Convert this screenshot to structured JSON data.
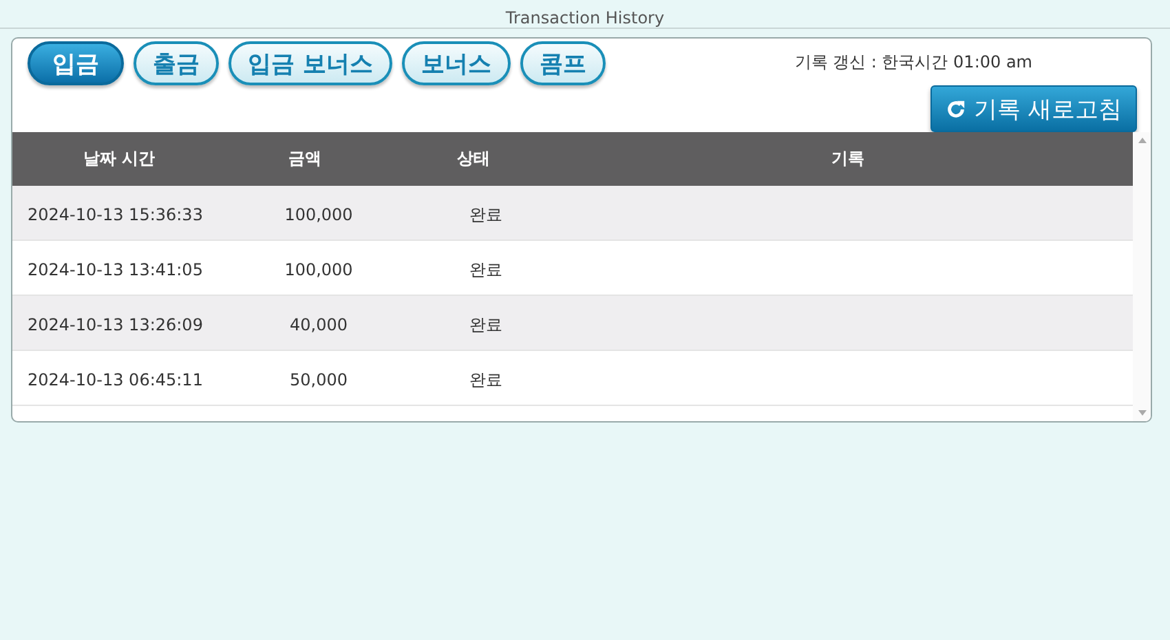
{
  "page_title": "Transaction History",
  "tabs": [
    {
      "label": "입금",
      "selected": true
    },
    {
      "label": "출금",
      "selected": false
    },
    {
      "label": "입금 보너스",
      "selected": false
    },
    {
      "label": "보너스",
      "selected": false
    },
    {
      "label": "콤프",
      "selected": false
    }
  ],
  "update_note": "기록 갱신 : 한국시간 01:00 am",
  "refresh_button": "기록 새로고침",
  "table": {
    "columns": [
      "날짜 시간",
      "금액",
      "상태",
      "기록"
    ],
    "rows": [
      [
        "2024-10-13 15:36:33",
        "100,000",
        "완료"
      ],
      [
        "2024-10-13 13:41:05",
        "100,000",
        "완료"
      ],
      [
        "2024-10-13 13:26:09",
        "40,000",
        "완료"
      ],
      [
        "2024-10-13 06:45:11",
        "50,000",
        "완료"
      ]
    ]
  }
}
